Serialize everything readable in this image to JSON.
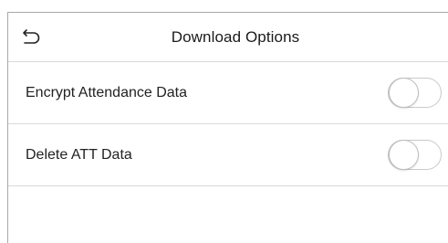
{
  "header": {
    "title": "Download Options",
    "back_icon": "back-arrow-icon"
  },
  "options": [
    {
      "label": "Encrypt Attendance Data",
      "enabled": false
    },
    {
      "label": "Delete ATT Data",
      "enabled": false
    }
  ],
  "colors": {
    "divider": "#d9d9d9",
    "toggle_border": "#c9c9c9",
    "text": "#222222"
  }
}
